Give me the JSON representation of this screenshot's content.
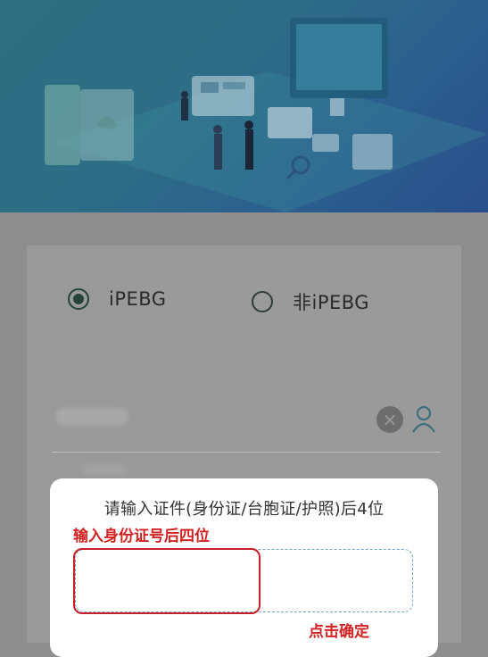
{
  "login": {
    "option_ipebg": "iPEBG",
    "option_non_ipebg": "非iPEBG",
    "selected": "iPEBG"
  },
  "modal": {
    "title": "请输入证件(身份证/台胞证/护照)后4位",
    "code_value": ""
  },
  "annotations": {
    "input_hint": "输入身份证号后四位",
    "confirm_hint": "点击确定"
  },
  "colors": {
    "accent_red": "#d32222",
    "radio_selected": "#24443a",
    "hero_teal": "#2f6f7f",
    "dashed_border": "#6fa8c9"
  },
  "icons": {
    "clear": "close-circle-icon",
    "user": "user-icon"
  }
}
